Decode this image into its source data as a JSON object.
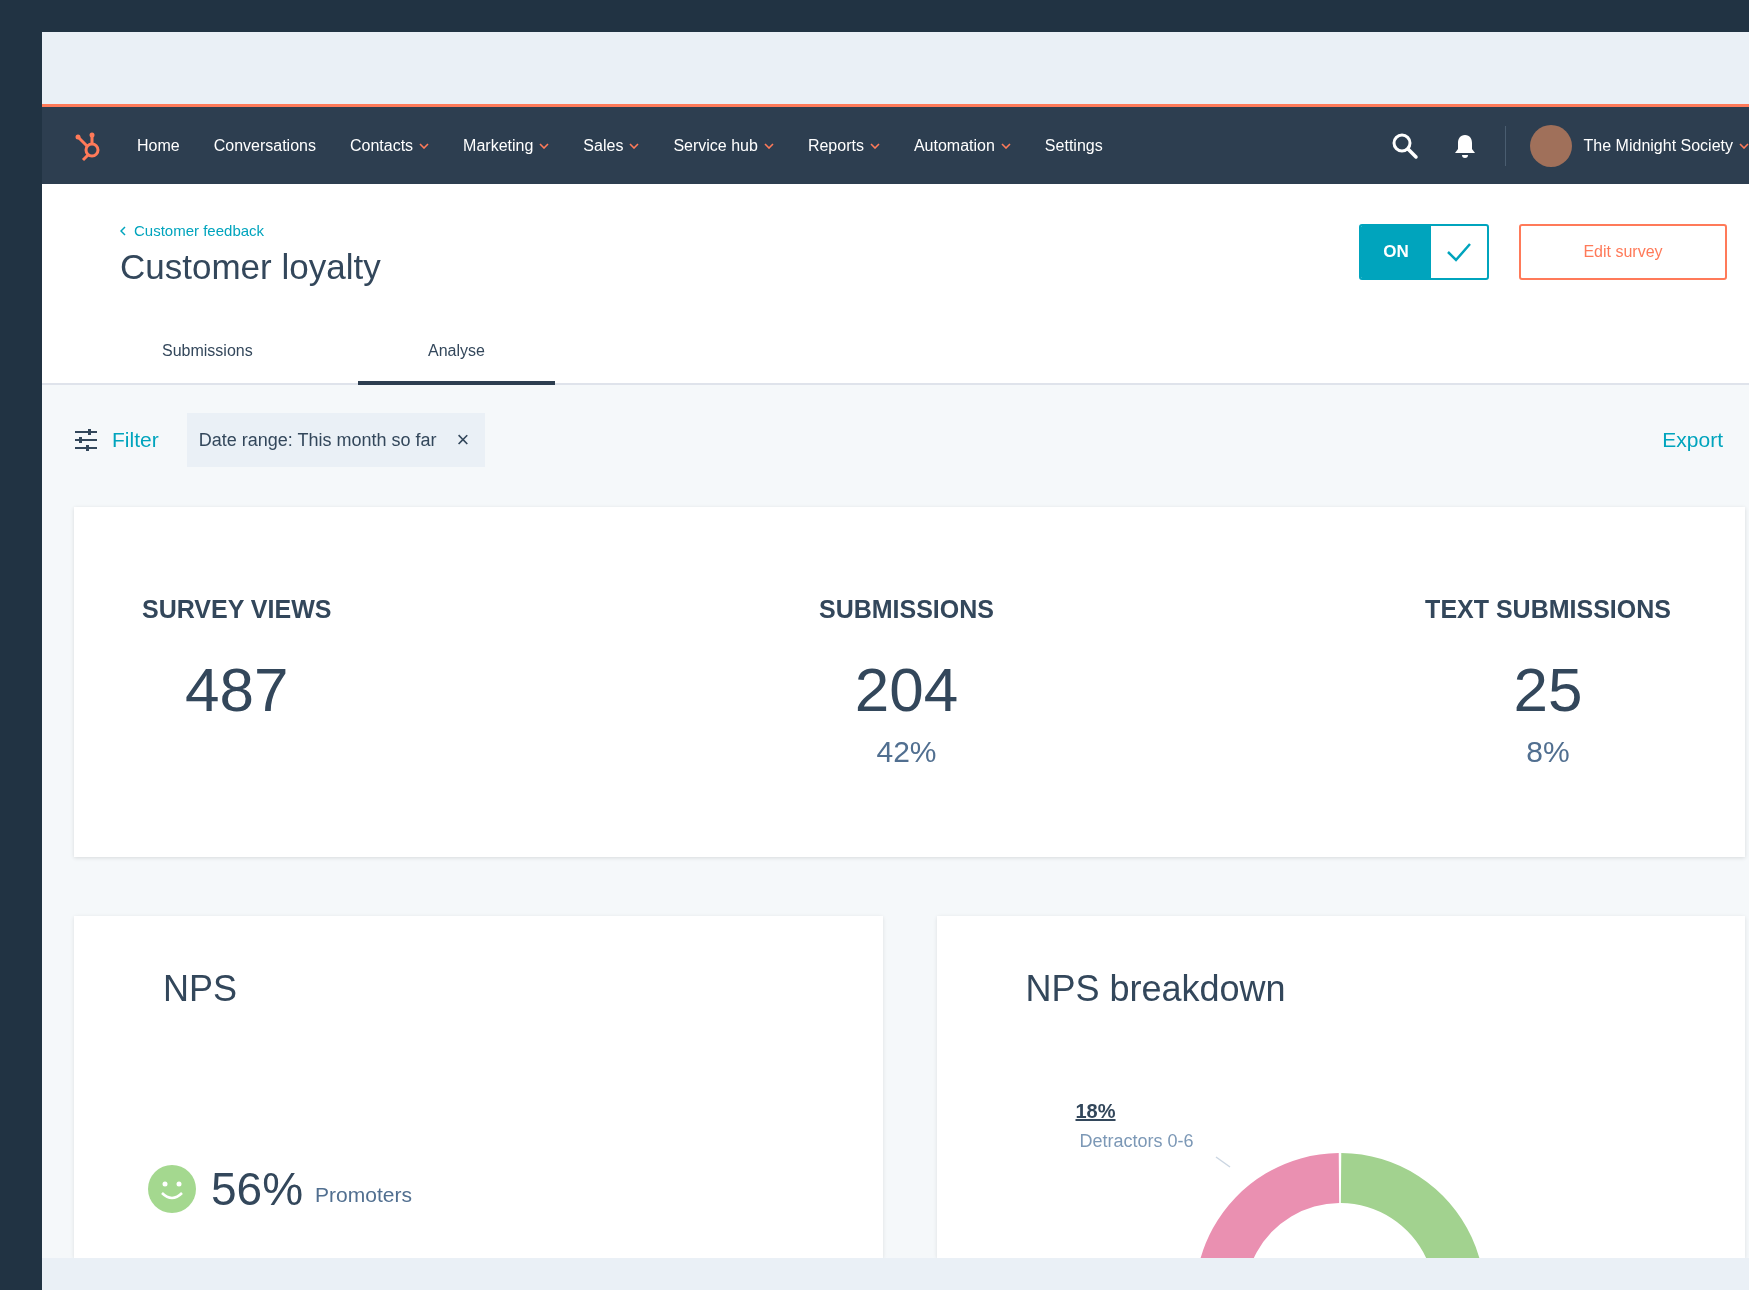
{
  "nav": {
    "items": [
      {
        "label": "Home",
        "has_menu": false
      },
      {
        "label": "Conversations",
        "has_menu": false
      },
      {
        "label": "Contacts",
        "has_menu": true
      },
      {
        "label": "Marketing",
        "has_menu": true
      },
      {
        "label": "Sales",
        "has_menu": true
      },
      {
        "label": "Service hub",
        "has_menu": true
      },
      {
        "label": "Reports",
        "has_menu": true
      },
      {
        "label": "Automation",
        "has_menu": true
      },
      {
        "label": "Settings",
        "has_menu": false
      }
    ],
    "account": {
      "name": "The Midnight Society",
      "has_menu": true
    }
  },
  "header": {
    "breadcrumb": "Customer feedback",
    "title": "Customer loyalty",
    "toggle": {
      "label": "ON",
      "on": true
    },
    "edit_button": "Edit survey"
  },
  "tabs": [
    {
      "label": "Submissions",
      "selected": false
    },
    {
      "label": "Analyse",
      "selected": true
    }
  ],
  "filter": {
    "label": "Filter",
    "chip": "Date range: This month so far",
    "chip_close": "×",
    "export": "Export"
  },
  "stats": [
    {
      "label": "SURVEY VIEWS",
      "value": "487"
    },
    {
      "label": "SUBMISSIONS",
      "value": "204",
      "percent": "42%"
    },
    {
      "label": "TEXT SUBMISSIONS",
      "value": "25",
      "percent": "8%"
    }
  ],
  "nps": {
    "title": "NPS",
    "value": "56%",
    "caption": "Promoters"
  },
  "breakdown": {
    "title": "NPS breakdown",
    "label_value": "18%",
    "label_text": "Detractors 0-6"
  }
}
